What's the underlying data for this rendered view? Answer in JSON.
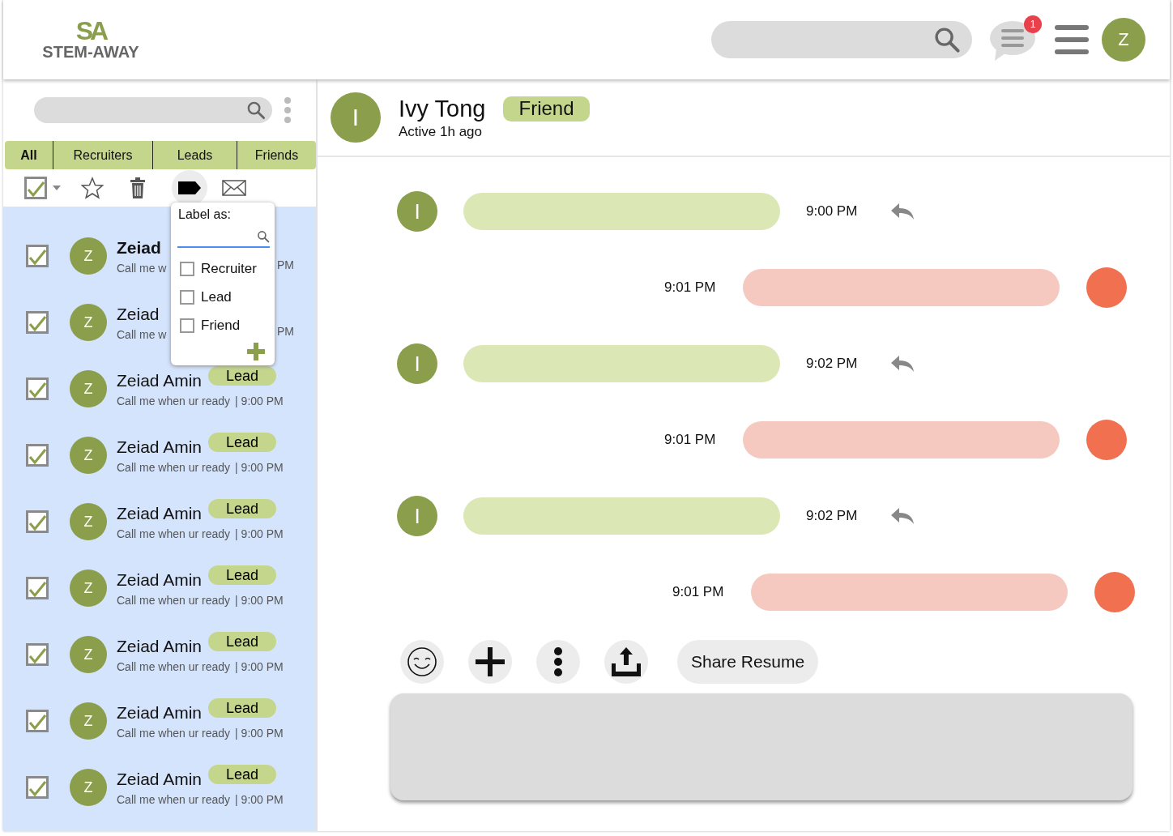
{
  "header": {
    "logo_mark": "SA",
    "logo_text": "STEM-AWAY",
    "notification_count": "1",
    "user_initial": "Z"
  },
  "sidebar": {
    "tabs": [
      {
        "label": "All",
        "selected": true
      },
      {
        "label": "Recruiters",
        "selected": false
      },
      {
        "label": "Leads",
        "selected": false
      },
      {
        "label": "Friends",
        "selected": false
      }
    ],
    "select_all_checked": true,
    "label_menu": {
      "title": "Label as:",
      "options": [
        {
          "label": "Recruiter",
          "checked": false
        },
        {
          "label": "Lead",
          "checked": false
        },
        {
          "label": "Friend",
          "checked": false
        }
      ]
    },
    "conversations": [
      {
        "kind": "covered",
        "initial": "Z",
        "name": "Zeiad",
        "preview": "Call me w",
        "time": "PM",
        "checked": true,
        "unread": true
      },
      {
        "kind": "covered",
        "initial": "Z",
        "name": "Zeiad",
        "preview": "Call me w",
        "time": "PM",
        "checked": true,
        "unread": false
      },
      {
        "kind": "full",
        "initial": "Z",
        "name": "Zeiad Amin",
        "tag": "Lead",
        "preview": "Call me when ur ready",
        "time": "| 9:00 PM",
        "checked": true,
        "unread": false
      },
      {
        "kind": "full",
        "initial": "Z",
        "name": "Zeiad Amin",
        "tag": "Lead",
        "preview": "Call me when ur ready",
        "time": "| 9:00 PM",
        "checked": true,
        "unread": false
      },
      {
        "kind": "full",
        "initial": "Z",
        "name": "Zeiad Amin",
        "tag": "Lead",
        "preview": "Call me when ur ready",
        "time": "| 9:00 PM",
        "checked": true,
        "unread": false
      },
      {
        "kind": "full",
        "initial": "Z",
        "name": "Zeiad Amin",
        "tag": "Lead",
        "preview": "Call me when ur ready",
        "time": "| 9:00 PM",
        "checked": true,
        "unread": false
      },
      {
        "kind": "full",
        "initial": "Z",
        "name": "Zeiad Amin",
        "tag": "Lead",
        "preview": "Call me when ur ready",
        "time": "| 9:00 PM",
        "checked": true,
        "unread": false
      },
      {
        "kind": "full",
        "initial": "Z",
        "name": "Zeiad Amin",
        "tag": "Lead",
        "preview": "Call me when ur ready",
        "time": "| 9:00 PM",
        "checked": true,
        "unread": false
      },
      {
        "kind": "full",
        "initial": "Z",
        "name": "Zeiad Amin",
        "tag": "Lead",
        "preview": "Call me when ur ready",
        "time": "| 9:00 PM",
        "checked": true,
        "unread": false
      }
    ]
  },
  "chat": {
    "contact": {
      "initial": "I",
      "name": "Ivy Tong",
      "tag": "Friend",
      "status": "Active 1h ago"
    },
    "messages": [
      {
        "kind": "incoming",
        "initial": "I",
        "time": "9:00 PM"
      },
      {
        "kind": "outgoing",
        "time": "9:01 PM"
      },
      {
        "kind": "incoming",
        "initial": "I",
        "time": "9:02 PM"
      },
      {
        "kind": "outgoing",
        "time": "9:01 PM"
      },
      {
        "kind": "incoming",
        "initial": "I",
        "time": "9:02 PM"
      },
      {
        "kind": "outgoing",
        "time": "9:01 PM"
      }
    ],
    "share_button": "Share Resume"
  }
}
